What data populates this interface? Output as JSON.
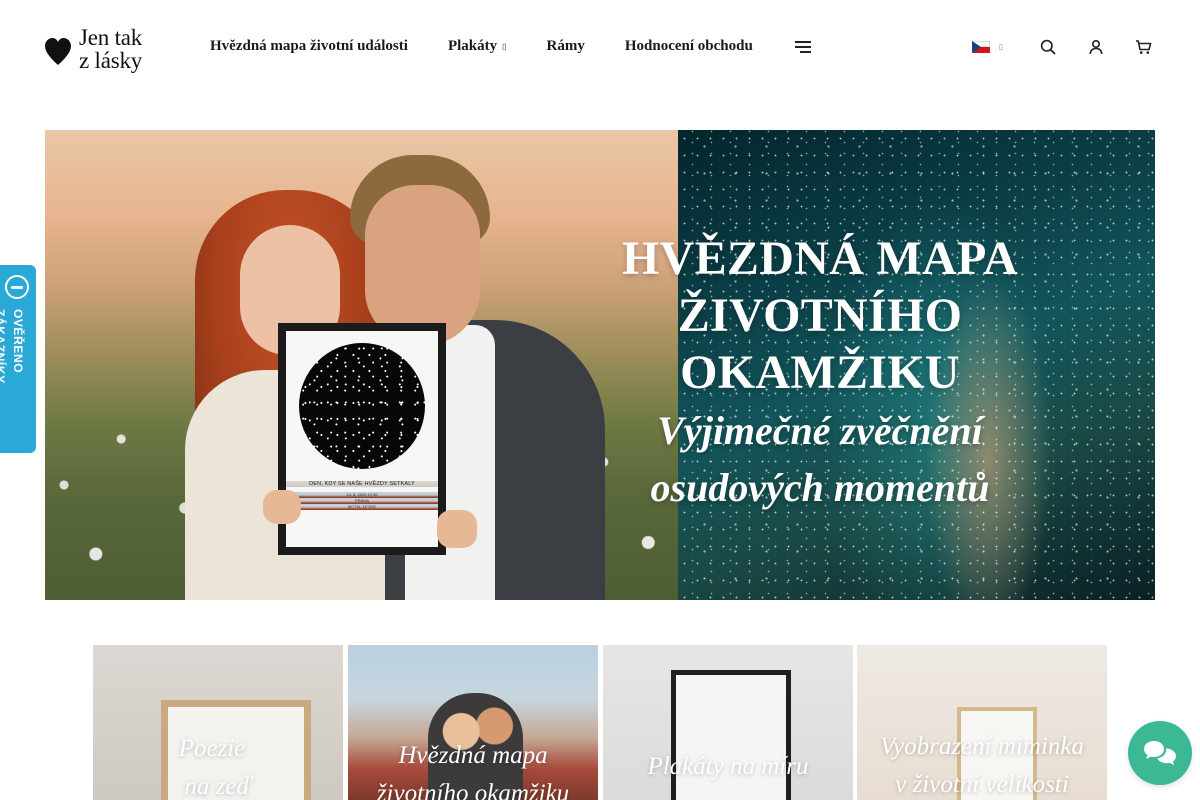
{
  "logo": {
    "line1": "Jen tak",
    "line2": "z lásky",
    "icon": "heart-icon"
  },
  "nav": {
    "items": [
      {
        "label": "Hvězdná mapa životní události",
        "has_dropdown": false
      },
      {
        "label": "Plakáty",
        "has_dropdown": true
      },
      {
        "label": "Rámy",
        "has_dropdown": false
      },
      {
        "label": "Hodnocení obchodu",
        "has_dropdown": false
      }
    ],
    "dropdown_caret": "▯",
    "more_icon": "menu-icon"
  },
  "tools": {
    "language": {
      "flag": "flag-cz-icon",
      "caret": "▯"
    },
    "icons": [
      "search-icon",
      "user-icon",
      "cart-icon"
    ]
  },
  "hero": {
    "title_line1": "HVĚZDNÁ MAPA",
    "title_line2": "ŽIVOTNÍHO OKAMŽIKU",
    "subtitle_line1": "Výjimečné zvěčnění",
    "subtitle_line2": "osudových momentů",
    "poster_caption": "DEN, KDY SE NAŠE HVĚZDY SETKALY",
    "poster_details_line1": "14. 8. 2020 12:30",
    "poster_details_line2": "PRAHA",
    "poster_details_line3": "50°7'N, 14°25'E"
  },
  "badge": {
    "label": "OVĚŘENO ZÁKAZNÍKY",
    "accent": "#2aa8d6"
  },
  "tiles": [
    {
      "line1": "Poezie",
      "line2": "na zeď"
    },
    {
      "line1": "Hvězdná mapa",
      "line2": "životního okamžiku"
    },
    {
      "line1": "Plakáty na míru",
      "line2": ""
    },
    {
      "line1": "Vyobrazení miminka",
      "line2": "v životní velikosti"
    }
  ],
  "chat": {
    "icon": "chat-icon",
    "color": "#3cb895"
  }
}
